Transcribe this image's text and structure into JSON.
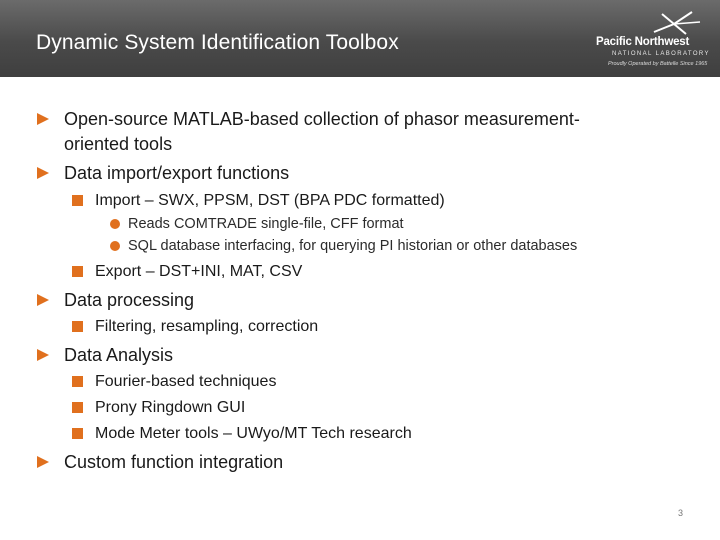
{
  "slide": {
    "title": "Dynamic System Identification Toolbox",
    "page_number": "3"
  },
  "logo": {
    "name": "Pacific Northwest",
    "lab_text": "NATIONAL LABORATORY",
    "tagline": "Proudly Operated by Battelle Since 1965"
  },
  "bullets": {
    "b1_line1": "Open-source MATLAB-based collection of phasor measurement-",
    "b1_line2": "oriented tools",
    "b2": "Data import/export functions",
    "b2_1": "Import – SWX, PPSM, DST (BPA PDC formatted)",
    "b2_1_1": "Reads COMTRADE single-file, CFF format",
    "b2_1_2": "SQL database interfacing, for querying PI historian or other databases",
    "b2_2": "Export – DST+INI, MAT, CSV",
    "b3": "Data processing",
    "b3_1": "Filtering, resampling, correction",
    "b4": "Data Analysis",
    "b4_1": "Fourier-based techniques",
    "b4_2": "Prony Ringdown GUI",
    "b4_3": "Mode Meter tools – UWyo/MT Tech research",
    "b5": "Custom function integration"
  },
  "colors": {
    "accent": "#e0701e",
    "header": "#4a4a4a"
  }
}
